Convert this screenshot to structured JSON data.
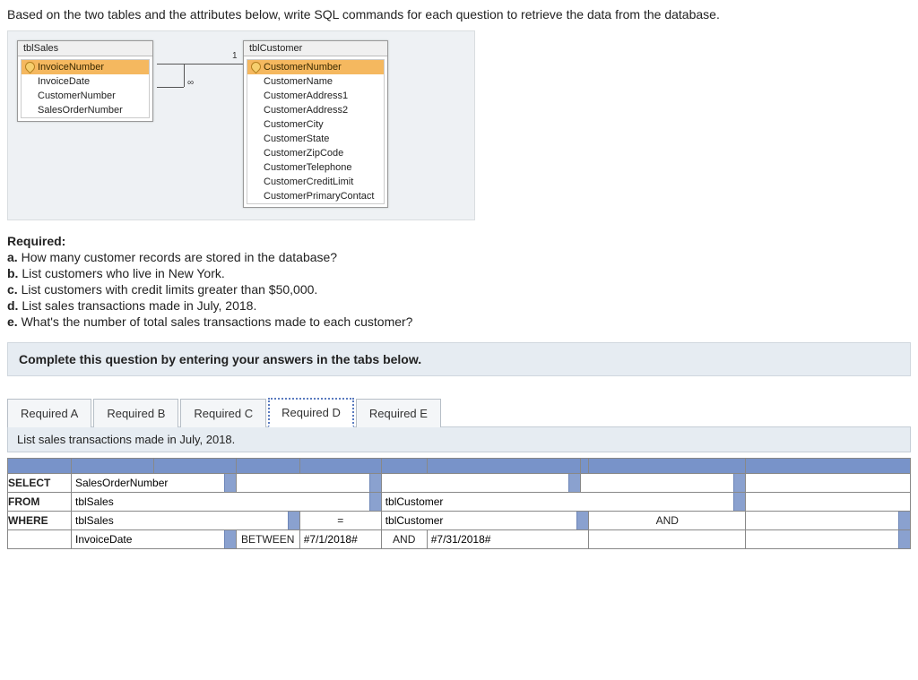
{
  "question": "Based on the two tables and the attributes below, write SQL commands for each question to retrieve the data from the database.",
  "diagram": {
    "tables": [
      {
        "name": "tblSales",
        "pk": "InvoiceNumber",
        "fields": [
          "InvoiceNumber",
          "InvoiceDate",
          "CustomerNumber",
          "SalesOrderNumber"
        ]
      },
      {
        "name": "tblCustomer",
        "pk": "CustomerNumber",
        "fields": [
          "CustomerNumber",
          "CustomerName",
          "CustomerAddress1",
          "CustomerAddress2",
          "CustomerCity",
          "CustomerState",
          "CustomerZipCode",
          "CustomerTelephone",
          "CustomerCreditLimit",
          "CustomerPrimaryContact"
        ]
      }
    ],
    "rel": {
      "left": "∞",
      "right": "1"
    }
  },
  "required": {
    "heading": "Required:",
    "items": [
      "a. How many customer records are stored in the database?",
      "b. List customers who live in New York.",
      "c. List customers with credit limits greater than $50,000.",
      "d. List sales transactions made in July, 2018.",
      "e. What's the number of total sales transactions made to each customer?"
    ]
  },
  "instruction": "Complete this question by entering your answers in the tabs below.",
  "tabs": [
    "Required A",
    "Required B",
    "Required C",
    "Required D",
    "Required E"
  ],
  "active_tab": 3,
  "tab_prompt": "List sales transactions made in July, 2018.",
  "sql_grid": {
    "row_select": {
      "label": "SELECT",
      "c1": "SalesOrderNumber"
    },
    "row_from": {
      "label": "FROM",
      "c1": "tblSales",
      "c4": "tblCustomer"
    },
    "row_where": {
      "label": "WHERE",
      "c1": "tblSales",
      "c3": "=",
      "c4": "tblCustomer",
      "c6": "AND"
    },
    "row_cond": {
      "c1": "InvoiceDate",
      "c2": "BETWEEN",
      "c2b": "#7/1/2018#",
      "c3": "AND",
      "c4": "#7/31/2018#"
    }
  }
}
